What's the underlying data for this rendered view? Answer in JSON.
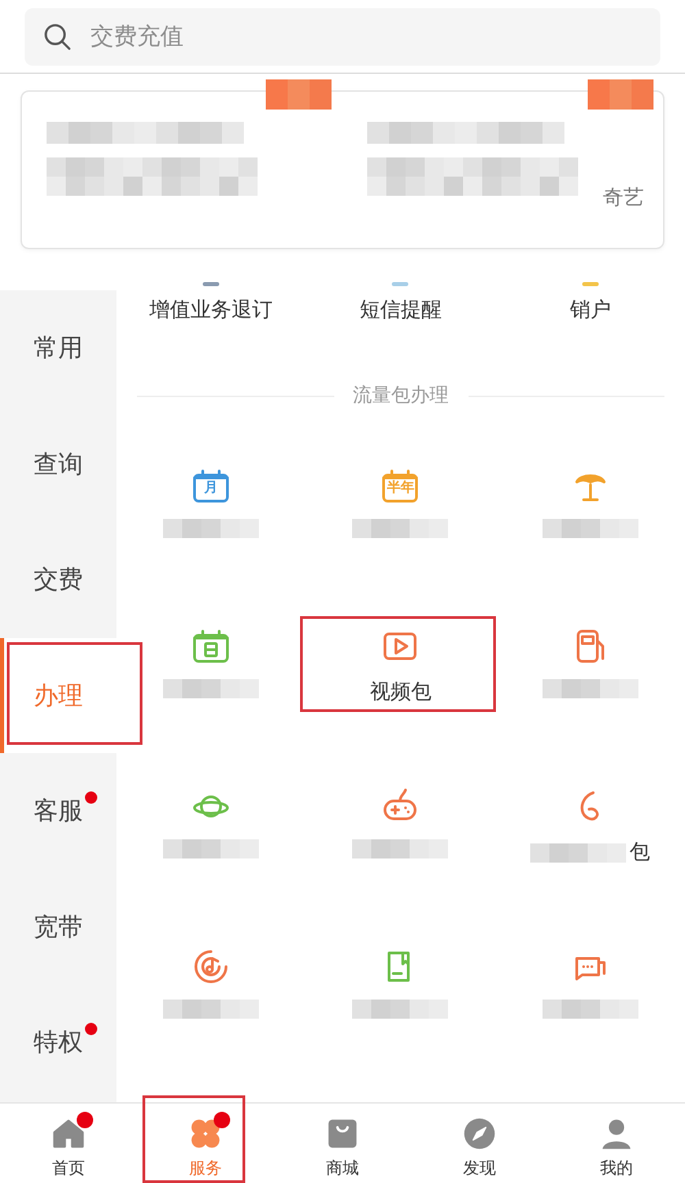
{
  "search": {
    "placeholder": "交费充值"
  },
  "promo_cards": [
    {
      "obscured": true
    },
    {
      "obscured": true,
      "text": "奇艺"
    }
  ],
  "sidebar": {
    "items": [
      {
        "label": "常用",
        "selected": false,
        "badge": false,
        "annotated": false
      },
      {
        "label": "查询",
        "selected": false,
        "badge": false,
        "annotated": false
      },
      {
        "label": "交费",
        "selected": false,
        "badge": false,
        "annotated": false
      },
      {
        "label": "办理",
        "selected": true,
        "badge": false,
        "annotated": true
      },
      {
        "label": "客服",
        "selected": false,
        "badge": true,
        "annotated": false
      },
      {
        "label": "宽带",
        "selected": false,
        "badge": false,
        "annotated": false
      },
      {
        "label": "特权",
        "selected": false,
        "badge": true,
        "annotated": false
      }
    ]
  },
  "quick_links": [
    {
      "label": "增值业务退订",
      "color": "#8a9bb0"
    },
    {
      "label": "短信提醒",
      "color": "#a8cfe8"
    },
    {
      "label": "销户",
      "color": "#f3c44a"
    }
  ],
  "section_title": "流量包办理",
  "tiles": [
    {
      "kind": "calendar",
      "color": "#3d95dc",
      "icon_text": "月",
      "obscured": true,
      "annotated": false
    },
    {
      "kind": "calendar",
      "color": "#f2a22c",
      "icon_text": "半年",
      "obscured": true,
      "annotated": false
    },
    {
      "kind": "palm",
      "color": "#f2a22c",
      "obscured": true,
      "annotated": false
    },
    {
      "kind": "calendar",
      "color": "#6cbf4a",
      "obscured": true,
      "annotated": false
    },
    {
      "kind": "play",
      "color": "#ef7548",
      "label": "视频包",
      "obscured": false,
      "annotated": true
    },
    {
      "kind": "fuel",
      "color": "#ef7548",
      "obscured": true,
      "annotated": false
    },
    {
      "kind": "planet",
      "color": "#6cbf4a",
      "obscured": true,
      "annotated": false
    },
    {
      "kind": "gamepad",
      "color": "#ef7548",
      "obscured": true,
      "annotated": false
    },
    {
      "kind": "loop",
      "color": "#ef7548",
      "label": "包",
      "obscured": true,
      "annotated": false
    },
    {
      "kind": "music",
      "color": "#ef7548",
      "obscured": true,
      "annotated": false
    },
    {
      "kind": "book",
      "color": "#6cbf4a",
      "obscured": true,
      "annotated": false
    },
    {
      "kind": "chat",
      "color": "#ef7548",
      "obscured": true,
      "annotated": false
    }
  ],
  "tab_bar": [
    {
      "label": "首页",
      "kind": "home",
      "selected": false,
      "badge": true,
      "annotated": false
    },
    {
      "label": "服务",
      "kind": "clover",
      "selected": true,
      "badge": true,
      "annotated": true
    },
    {
      "label": "商城",
      "kind": "bag",
      "selected": false,
      "badge": false,
      "annotated": false
    },
    {
      "label": "发现",
      "kind": "compass",
      "selected": false,
      "badge": false,
      "annotated": false
    },
    {
      "label": "我的",
      "kind": "person",
      "selected": false,
      "badge": false,
      "annotated": false
    }
  ]
}
